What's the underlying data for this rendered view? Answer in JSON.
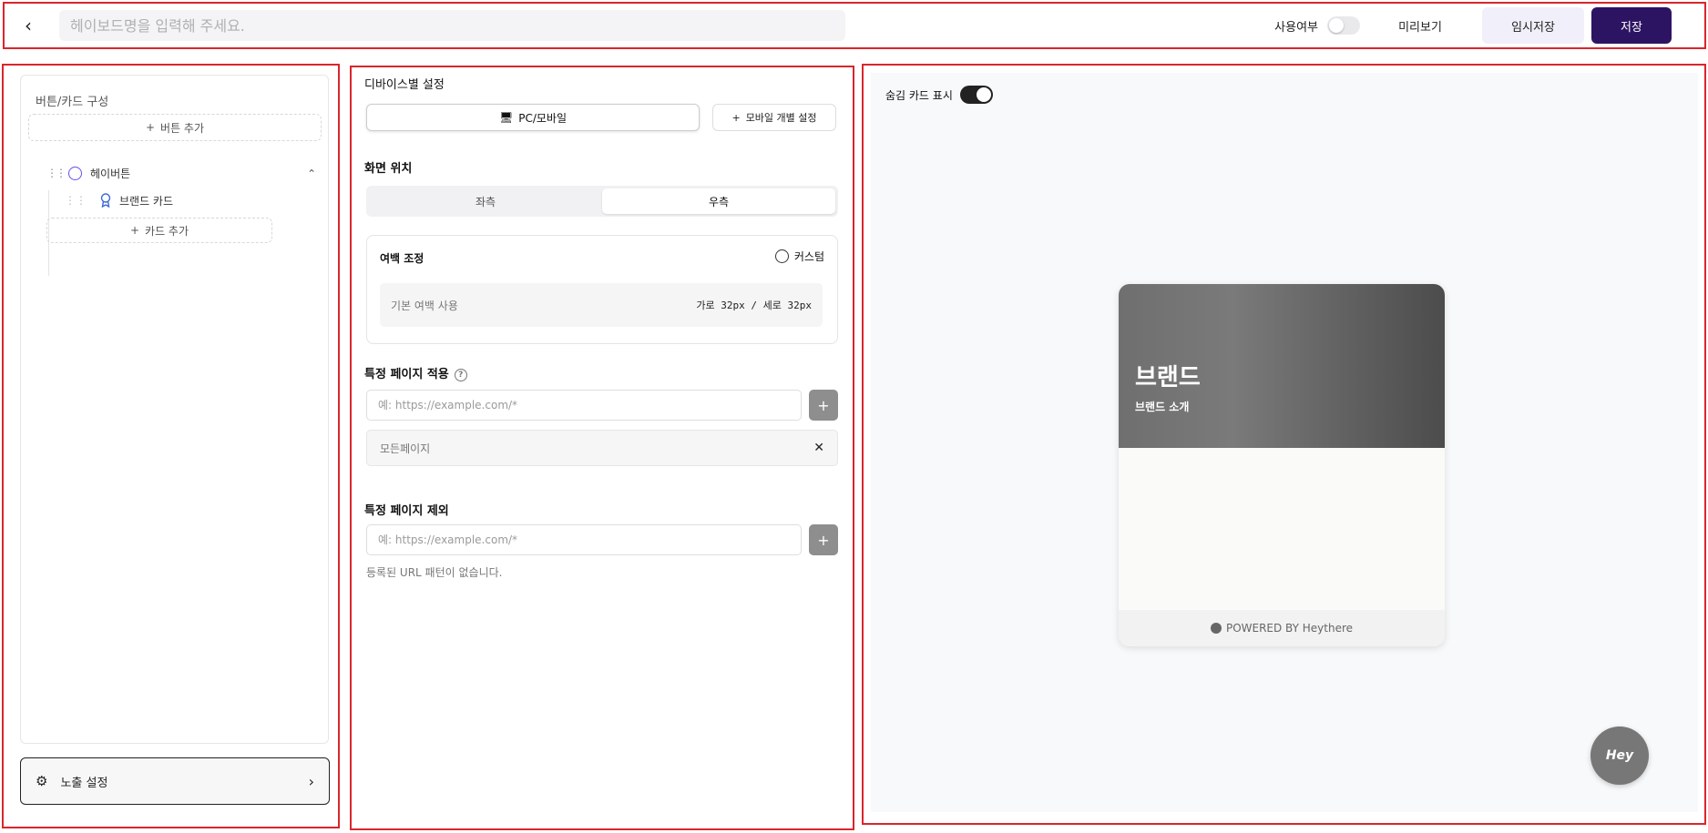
{
  "header": {
    "name_placeholder": "헤이보드명을 입력해 주세요.",
    "use_label": "사용여부",
    "use_enabled": false,
    "preview_label": "미리보기",
    "draft_label": "임시저장",
    "save_label": "저장"
  },
  "left": {
    "title": "버튼/카드 구성",
    "add_button_label": "버튼 추가",
    "button_item_label": "헤이버튼",
    "card_item_label": "브랜드 카드",
    "add_card_label": "카드 추가",
    "expose_label": "노출 설정"
  },
  "middle": {
    "device_title": "디바이스별 설정",
    "device_pc_label": "PC/모바일",
    "device_mobile_label": "모바일 개별 설정",
    "position_title": "화면 위치",
    "position_left": "좌측",
    "position_right": "우측",
    "position_selected": "우측",
    "margin_title": "여백 조정",
    "margin_custom": "커스텀",
    "margin_default": "기본 여백 사용",
    "margin_value": "가로 32px / 세로 32px",
    "include_title": "특정 페이지 적용",
    "include_placeholder": "예: https://example.com/*",
    "include_item": "모든페이지",
    "exclude_title": "특정 페이지 제외",
    "exclude_placeholder": "예: https://example.com/*",
    "exclude_empty": "등록된 URL 패턴이 없습니다."
  },
  "right": {
    "hidden_card_label": "숨김 카드 표시",
    "hidden_card_enabled": true,
    "card_title": "브랜드",
    "card_subtitle": "브랜드 소개",
    "powered_by": "POWERED BY Heythere",
    "hey_button": "Hey"
  },
  "colors": {
    "accent": "#2d1463",
    "draft_bg": "#f1eff9",
    "frame": "#d9262c"
  }
}
